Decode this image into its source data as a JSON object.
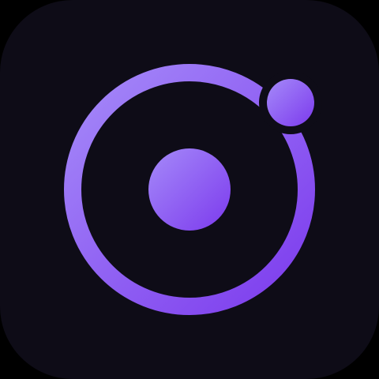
{
  "icon": {
    "name": "ionic-style-app-icon",
    "glyph": "orbit-ring-icon",
    "colors": {
      "page_background": "#000000",
      "tile_background": "#0e0c17",
      "gradient_light": "#a58af9",
      "gradient_dark": "#7c3aed",
      "ring": "#9568f3"
    }
  }
}
